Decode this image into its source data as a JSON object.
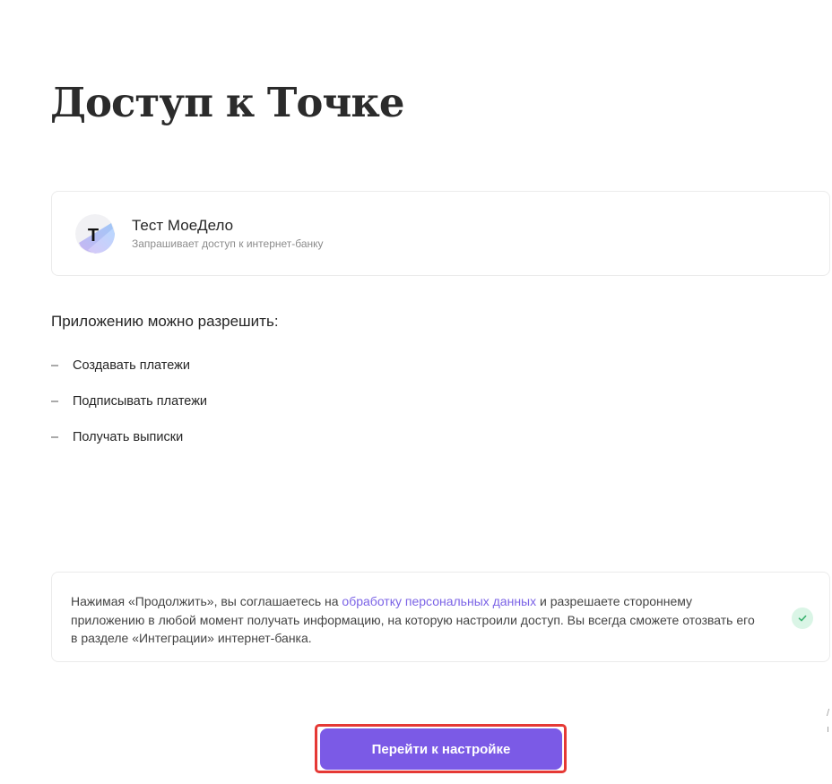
{
  "page": {
    "title": "Доступ к Точке"
  },
  "app": {
    "name": "Тест МоеДело",
    "subtitle": "Запрашивает доступ к интернет-банку",
    "logo_letter": "T",
    "logo_icon": "app-logo-icon"
  },
  "permissions": {
    "heading": "Приложению можно разрешить:",
    "dash": "–",
    "items": [
      "Создавать платежи",
      "Подписывать платежи",
      "Получать выписки"
    ]
  },
  "consent": {
    "text_before": "Нажимая «Продолжить», вы соглашаетесь на ",
    "link_text": "обработку персональных данных",
    "text_after": " и разрешаете стороннему приложению в любой момент получать информацию, на которую настроили доступ. Вы всегда сможете отозвать его в разделе «Интеграции» интернет-банка.",
    "check_icon": "check-icon"
  },
  "actions": {
    "primary_label": "Перейти к настройке"
  },
  "edge_glyphs": [
    "/",
    "ı"
  ],
  "colors": {
    "accent": "#7b5ae6",
    "link": "#7b63e6",
    "highlight": "#e53935",
    "check_bg": "#daf5e6",
    "check_mark": "#3cb371"
  }
}
